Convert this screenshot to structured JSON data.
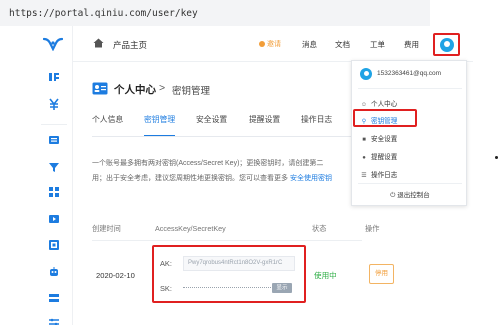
{
  "browser": {
    "url": "https://portal.qiniu.com/user/key"
  },
  "topnav": {
    "console_label": "产品主页",
    "invite_label": "邀请",
    "items": [
      "消息",
      "文档",
      "工单",
      "费用"
    ]
  },
  "page": {
    "title": "个人中心",
    "separator": ">",
    "subtitle": "密钥管理"
  },
  "tabs": [
    {
      "label": "个人信息",
      "active": false
    },
    {
      "label": "密钥管理",
      "active": true
    },
    {
      "label": "安全设置",
      "active": false
    },
    {
      "label": "提醒设置",
      "active": false
    },
    {
      "label": "操作日志",
      "active": false
    }
  ],
  "description": {
    "line1": "一个账号最多拥有两对密钥(Access/Secret Key)；更换密钥时，请创建第二",
    "line2_text": "用；出于安全考虑，建议您周期性地更换密钥。您可以查看更多",
    "line2_link": "安全使用密钥"
  },
  "table": {
    "headers": [
      "创建时间",
      "AccessKey/SecretKey",
      "状态",
      "操作"
    ],
    "rows": [
      {
        "created": "2020-02-10",
        "ak_label": "AK:",
        "ak_value": "Pwy7qrobus4ntRct1n8O2V-gxR1rC",
        "sk_label": "SK:",
        "sk_show_label": "显示",
        "status": "使用中",
        "action_label": "停用"
      }
    ]
  },
  "dropdown": {
    "email": "1532363461@qq.com",
    "items": [
      {
        "label": "个人中心",
        "icon": "user-icon",
        "active": false
      },
      {
        "label": "密钥管理",
        "icon": "key-icon",
        "active": true
      },
      {
        "label": "安全设置",
        "icon": "shield-icon",
        "active": false
      },
      {
        "label": "提醒设置",
        "icon": "bell-icon",
        "active": false
      },
      {
        "label": "操作日志",
        "icon": "log-icon",
        "active": false
      }
    ],
    "logout_label": "退出控制台"
  },
  "colors": {
    "accent": "#1d7ce0",
    "highlight": "#e02020",
    "status_active": "#2fae46",
    "warning": "#f29d38",
    "avatar": "#1fa3e5"
  }
}
